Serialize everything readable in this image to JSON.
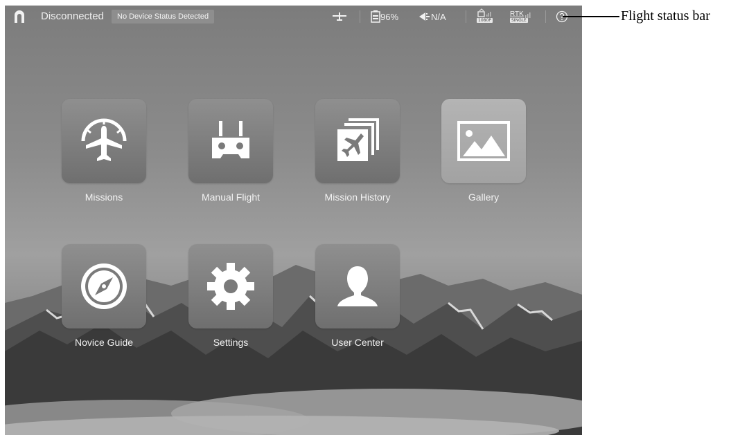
{
  "status_bar": {
    "connection": "Disconnected",
    "device_status": "No Device Status Detected",
    "battery": "96%",
    "signal": "N/A",
    "video_badge": "1080P",
    "rtk_label": "RTK",
    "rtk_badge": "SINGLE"
  },
  "apps": [
    {
      "label": "Missions",
      "icon": "plane-gauge-icon"
    },
    {
      "label": "Manual Flight",
      "icon": "remote-controller-icon"
    },
    {
      "label": "Mission History",
      "icon": "stacked-plane-cards-icon"
    },
    {
      "label": "Gallery",
      "icon": "image-icon"
    },
    {
      "label": "Novice Guide",
      "icon": "compass-icon"
    },
    {
      "label": "Settings",
      "icon": "gear-icon"
    },
    {
      "label": "User Center",
      "icon": "user-icon"
    }
  ],
  "annotation": {
    "label": "Flight status bar"
  }
}
